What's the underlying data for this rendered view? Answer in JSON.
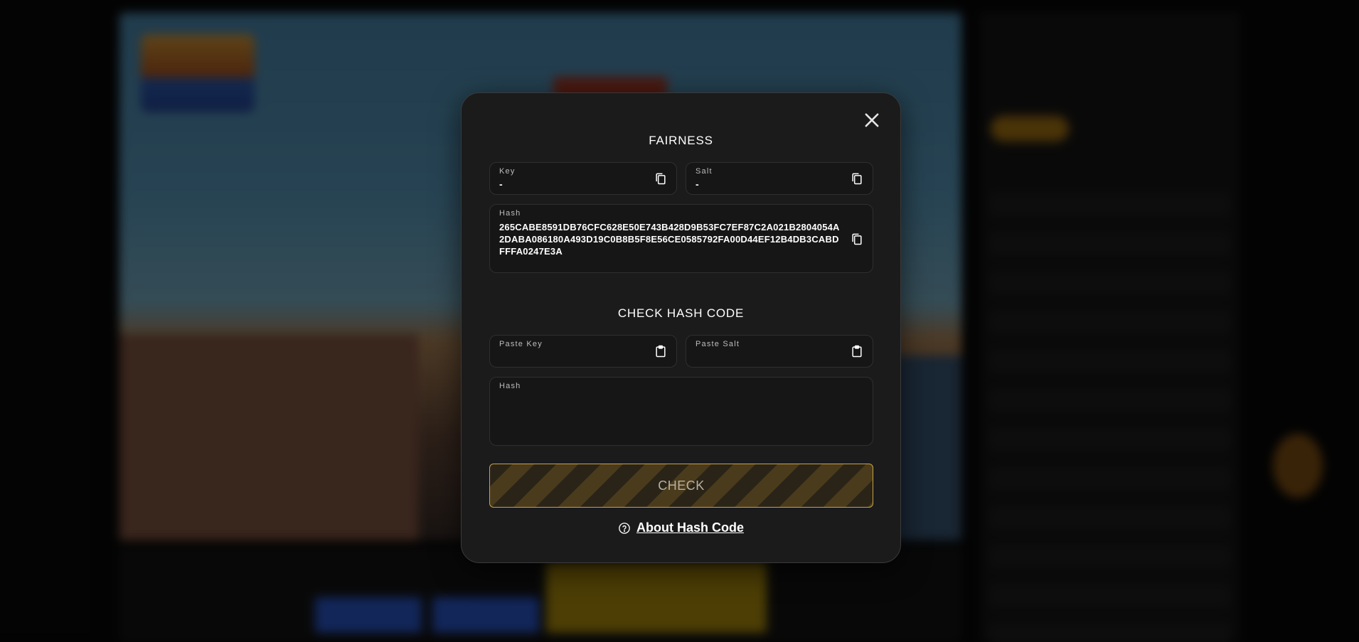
{
  "modal": {
    "title": "FAIRNESS",
    "close_icon": "close-icon",
    "key": {
      "label": "Key",
      "value": "-",
      "icon": "copy-icon"
    },
    "salt": {
      "label": "Salt",
      "value": "-",
      "icon": "copy-icon"
    },
    "hash": {
      "label": "Hash",
      "value": "265CABE8591DB76CFC628E50E743B428D9B53FC7EF87C2A021B2804054A2DABA086180A493D19C0B8B5F8E56CE0585792FA00D44EF12B4DB3CABDFFFA0247E3A",
      "icon": "copy-icon"
    },
    "check_section": {
      "title": "CHECK HASH CODE",
      "paste_key": {
        "label": "Paste Key",
        "value": "",
        "icon": "clipboard-icon"
      },
      "paste_salt": {
        "label": "Paste Salt",
        "value": "",
        "icon": "clipboard-icon"
      },
      "hash": {
        "label": "Hash",
        "value": ""
      },
      "check_button": "CHECK",
      "about_link": "About Hash Code",
      "about_icon": "question-circle-icon"
    }
  },
  "colors": {
    "modal_bg": "#1b1b1b",
    "field_bg": "#161616",
    "accent_border": "#c7a24a"
  }
}
